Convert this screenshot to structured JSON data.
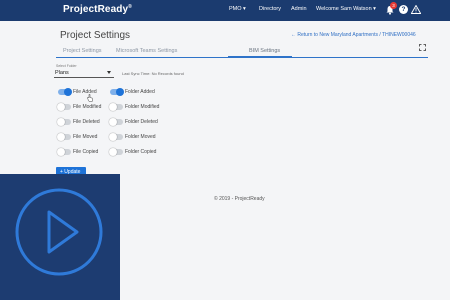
{
  "header": {
    "brand": "ProjectReady",
    "brand_mark": "®",
    "nav": {
      "pmo": "PMO ▾",
      "directory": "Directory",
      "admin": "Admin",
      "user": "Welcome Sam Watson ▾"
    },
    "notification_count": "3",
    "help_glyph": "?"
  },
  "page": {
    "title": "Project Settings",
    "return_link": "←  Return to New Maryland Apartments / THINEW00046"
  },
  "tabs": [
    {
      "label": "Project Settings",
      "active": false
    },
    {
      "label": "Microsoft Teams Settings",
      "active": false
    },
    {
      "label": "BIM Settings",
      "active": true
    }
  ],
  "folder_select": {
    "label": "Select Folder",
    "value": "Plans"
  },
  "sync_status": "Last Sync Time: No Records found",
  "toggles": {
    "file": [
      {
        "label": "File Added",
        "on": true
      },
      {
        "label": "File Modified",
        "on": false
      },
      {
        "label": "File Deleted",
        "on": false
      },
      {
        "label": "File Moved",
        "on": false
      },
      {
        "label": "File Copied",
        "on": false
      }
    ],
    "folder": [
      {
        "label": "Folder Added",
        "on": true
      },
      {
        "label": "Folder Modified",
        "on": false
      },
      {
        "label": "Folder Deleted",
        "on": false
      },
      {
        "label": "Folder Moved",
        "on": false
      },
      {
        "label": "Folder Copied",
        "on": false
      }
    ]
  },
  "update_button": "+ Update",
  "footer": "© 2019 - ProjectReady",
  "colors": {
    "topbar": "#1b3b6f",
    "accent": "#1e73d8",
    "overlay": "#1d3c71"
  }
}
